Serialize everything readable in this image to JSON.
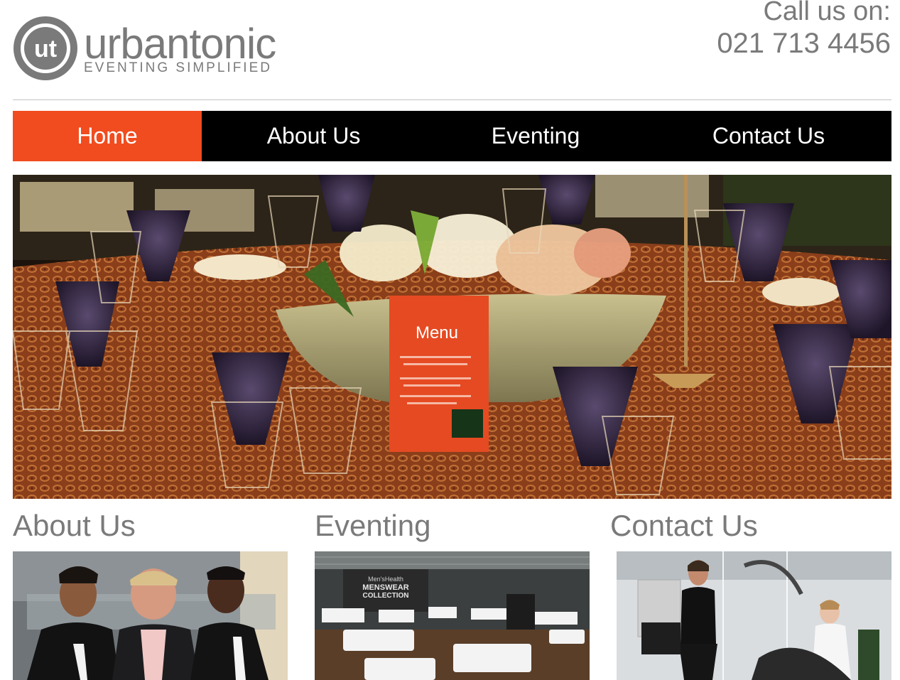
{
  "brand": {
    "logo_letters": "ut",
    "name": "urbantonic",
    "tagline": "EVENTING  SIMPLIFIED"
  },
  "contact": {
    "label": "Call us on:",
    "phone": "021 713 4456"
  },
  "nav": {
    "items": [
      {
        "label": "Home",
        "active": true
      },
      {
        "label": "About Us",
        "active": false
      },
      {
        "label": "Eventing",
        "active": false
      },
      {
        "label": "Contact Us",
        "active": false
      }
    ]
  },
  "hero": {
    "icon": "table-setting-photo",
    "menu_card_text": "Menu"
  },
  "sections": [
    {
      "title": "About Us",
      "image": "staff-photo"
    },
    {
      "title": "Eventing",
      "image": "venue-photo",
      "banner_line1": "Men'sHealth",
      "banner_line2": "MENSWEAR",
      "banner_line3": "COLLECTION"
    },
    {
      "title": "Contact Us",
      "image": "guests-photo"
    }
  ],
  "colors": {
    "accent": "#f14c1f",
    "nav_bg": "#000000",
    "text_gray": "#7a7a7a"
  }
}
